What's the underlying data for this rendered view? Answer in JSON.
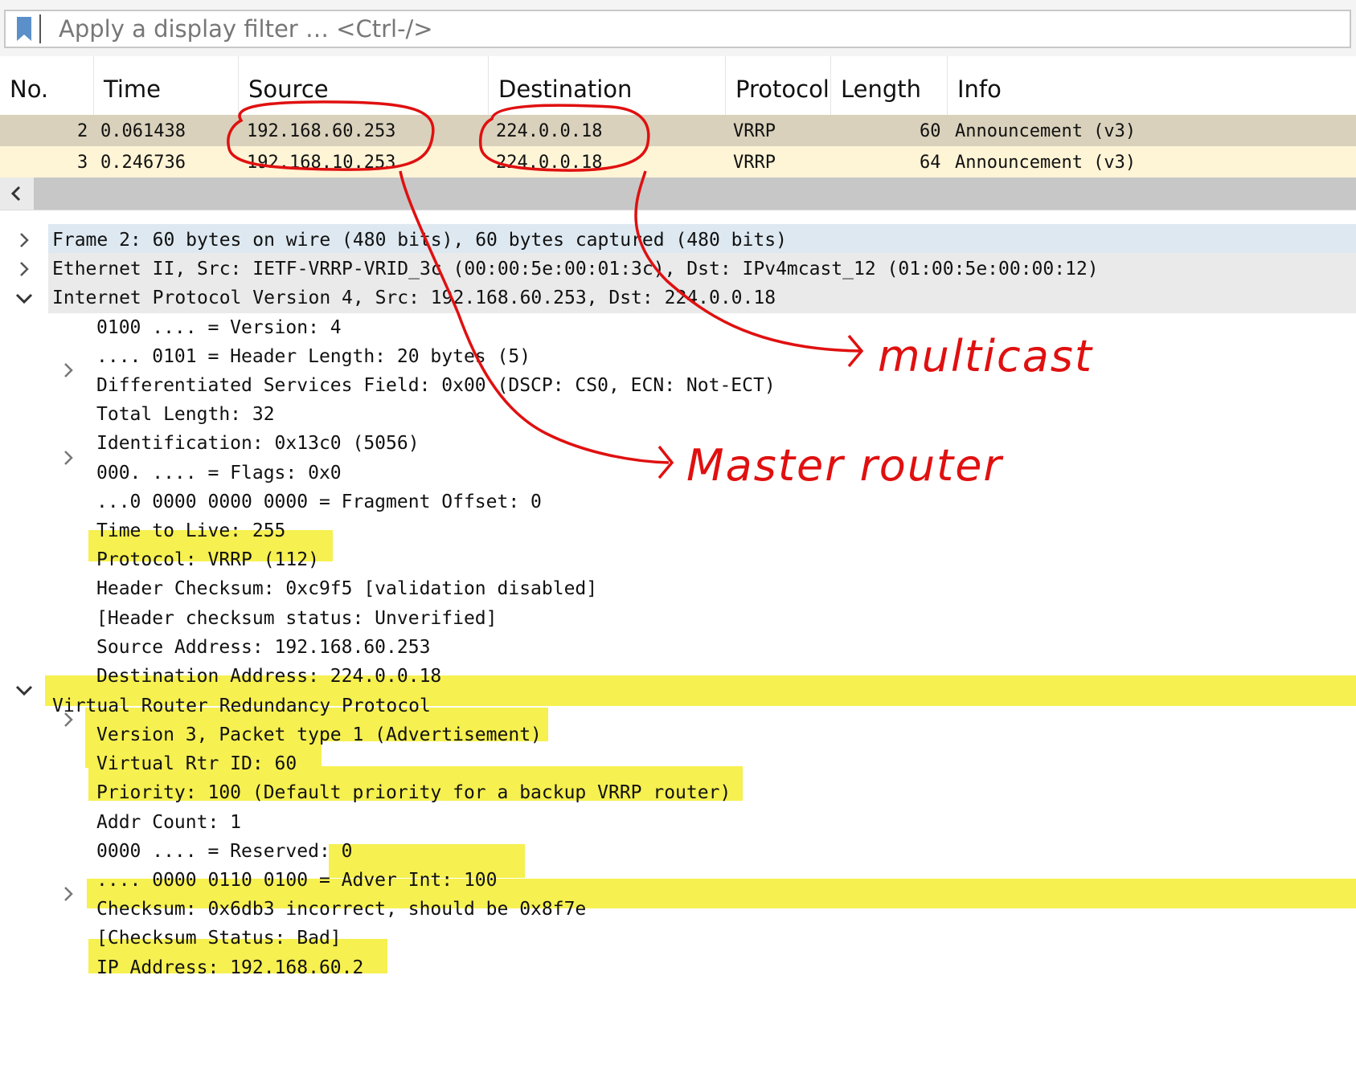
{
  "filter": {
    "placeholder": "Apply a display filter … <Ctrl-/>"
  },
  "columns": {
    "no": "No.",
    "time": "Time",
    "source": "Source",
    "destination": "Destination",
    "protocol": "Protocol",
    "length": "Length",
    "info": "Info"
  },
  "packets": [
    {
      "no": "2",
      "time": "0.061438",
      "source": "192.168.60.253",
      "destination": "224.0.0.18",
      "protocol": "VRRP",
      "length": "60",
      "info": "Announcement (v3)"
    },
    {
      "no": "3",
      "time": "0.246736",
      "source": "192.168.10.253",
      "destination": "224.0.0.18",
      "protocol": "VRRP",
      "length": "64",
      "info": "Announcement (v3)"
    }
  ],
  "details": {
    "frame": "Frame 2: 60 bytes on wire (480 bits), 60 bytes captured (480 bits)",
    "ethernet": "Ethernet II, Src: IETF-VRRP-VRID_3c (00:00:5e:00:01:3c), Dst: IPv4mcast_12 (01:00:5e:00:00:12)",
    "ipv4": "Internet Protocol Version 4, Src: 192.168.60.253, Dst: 224.0.0.18",
    "ip_fields": [
      "0100 .... = Version: 4",
      ".... 0101 = Header Length: 20 bytes (5)",
      "Differentiated Services Field: 0x00 (DSCP: CS0, ECN: Not-ECT)",
      "Total Length: 32",
      "Identification: 0x13c0 (5056)",
      "000. .... = Flags: 0x0",
      "...0 0000 0000 0000 = Fragment Offset: 0",
      "Time to Live: 255",
      "Protocol: VRRP (112)",
      "Header Checksum: 0xc9f5 [validation disabled]",
      "[Header checksum status: Unverified]",
      "Source Address: 192.168.60.253",
      "Destination Address: 224.0.0.18"
    ],
    "vrrp": "Virtual Router Redundancy Protocol",
    "vrrp_fields": [
      "Version 3, Packet type 1 (Advertisement)",
      "Virtual Rtr ID: 60",
      "Priority: 100 (Default priority for a backup VRRP router)",
      "Addr Count: 1",
      "0000 .... = Reserved: 0",
      ".... 0000 0110 0100 = Adver Int: 100",
      "Checksum: 0x6db3 incorrect, should be 0x8f7e",
      "[Checksum Status: Bad]",
      "IP Address: 192.168.60.2"
    ]
  },
  "annotations": {
    "multicast": "multicast",
    "master": "Master router"
  },
  "colors": {
    "selected_row": "#d9d1bb",
    "row": "#fef4d6",
    "frame_band": "#dde8f0",
    "proto_band": "#eaeaea",
    "highlight": "#f6f050",
    "annotation": "#e01010"
  }
}
